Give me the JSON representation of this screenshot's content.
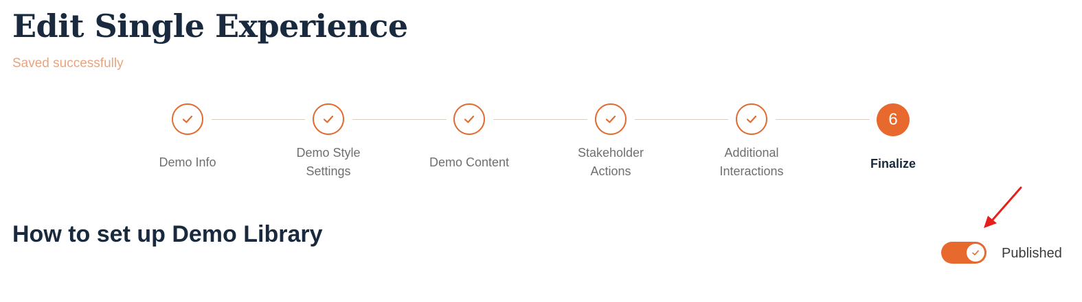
{
  "page": {
    "title": "Edit Single Experience",
    "save_status": "Saved successfully"
  },
  "stepper": {
    "steps": [
      {
        "label": "Demo Info",
        "state": "completed",
        "icon": "check-icon"
      },
      {
        "label": "Demo Style Settings",
        "state": "completed",
        "icon": "check-icon"
      },
      {
        "label": "Demo Content",
        "state": "completed",
        "icon": "check-icon"
      },
      {
        "label": "Stakeholder Actions",
        "state": "completed",
        "icon": "check-icon"
      },
      {
        "label": "Additional Interactions",
        "state": "completed",
        "icon": "check-icon"
      },
      {
        "label": "Finalize",
        "state": "active",
        "number": "6"
      }
    ]
  },
  "section": {
    "title": "How to set up Demo Library"
  },
  "publish_toggle": {
    "label": "Published",
    "checked": true,
    "icon": "check-icon"
  },
  "annotation": {
    "icon": "red-arrow-icon",
    "color": "#e5201c"
  },
  "colors": {
    "accent": "#e8692e",
    "status_text": "#e8a47f",
    "heading": "#1a2a3e",
    "connector": "#d7cfc3"
  }
}
